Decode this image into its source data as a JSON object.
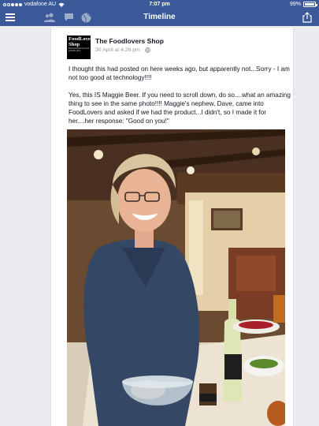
{
  "status_bar": {
    "carrier": "vodafone AU",
    "time": "7:07 pm",
    "battery": "99%"
  },
  "nav": {
    "title": "Timeline",
    "icons": [
      "menu-icon",
      "friend-requests-icon",
      "messages-icon",
      "notifications-globe-icon",
      "share-icon"
    ]
  },
  "post": {
    "page_name": "The Foodlovers Shop",
    "timestamp": "30 April at 4:26 pm",
    "avatar_logo": {
      "line1": "FoodLovers",
      "line2": "Shop",
      "tagline": "Delicious fine food and gourmet gifts"
    },
    "text": "I thought this had posted on here weeks ago, but apparently not...Sorry - I am not too good at technology!!!!\n\nYes, this IS Maggie Beer.  If you need to scroll down, do so....what an amazing thing to see in the same photo!!!!  Maggie's nephew, Dave, came into FoodLovers and asked if we had the product...I didn't, so I made it for her....her response:  \"Good on you!\""
  },
  "colors": {
    "facebook_blue": "#3b5998",
    "background": "#e9ebee",
    "card": "#ffffff",
    "text": "#141823",
    "meta": "#90949c"
  }
}
